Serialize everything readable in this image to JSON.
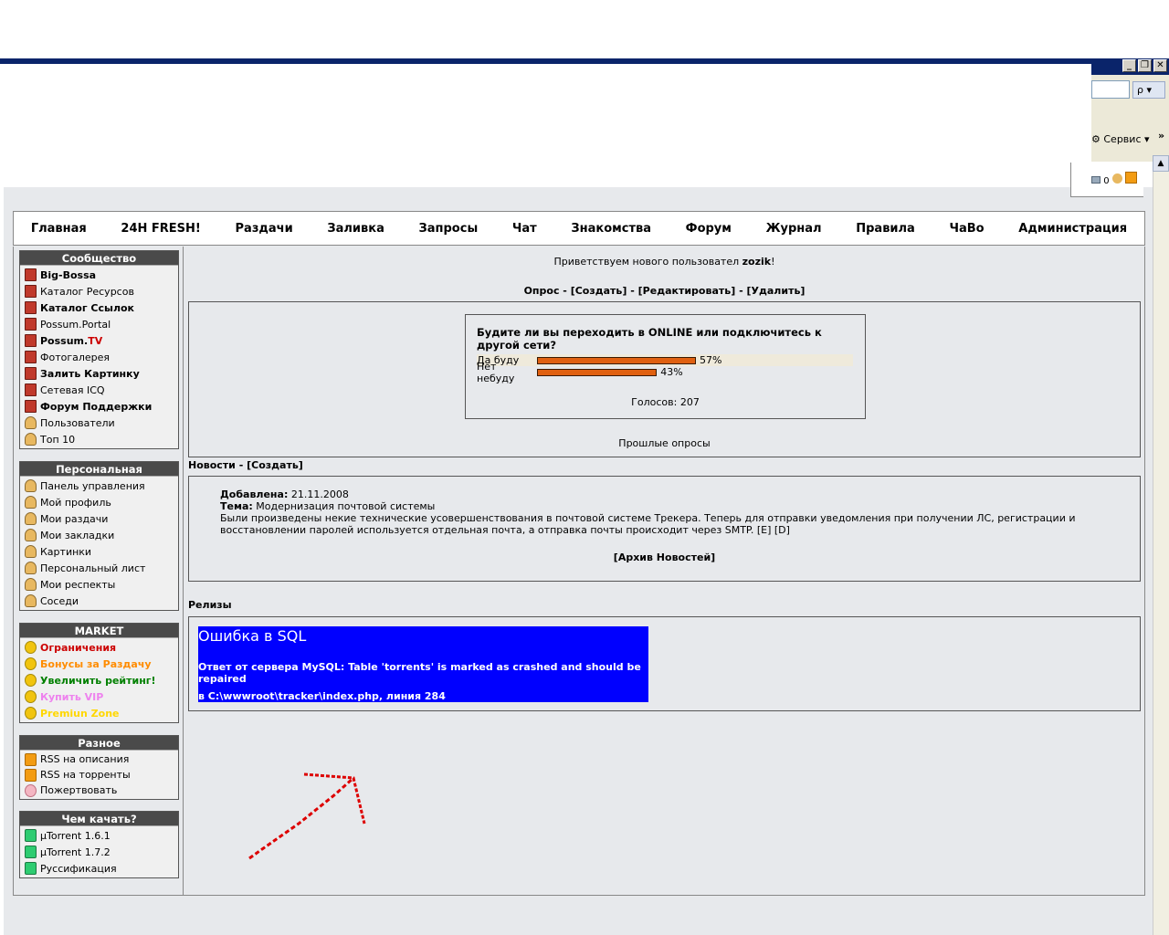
{
  "window": {
    "buttons": [
      "_",
      "❐",
      "✕"
    ]
  },
  "ie": {
    "service_label": "Сервис",
    "search_btn": "ρ ▾",
    "chevron": "»",
    "tray_count": "0"
  },
  "nav": [
    "Главная",
    "24H FRESH!",
    "Раздачи",
    "Заливка",
    "Запросы",
    "Чат",
    "Знакомства",
    "Форум",
    "Журнал",
    "Правила",
    "ЧаВо",
    "Администрация"
  ],
  "sidebar": {
    "community": {
      "title": "Сообщество",
      "items": [
        {
          "label": "Big-Bossa",
          "bold": true,
          "icon": "book-icon"
        },
        {
          "label": "Каталог Ресурсов",
          "bold": false,
          "icon": "book-icon"
        },
        {
          "label": "Каталог Ссылок",
          "bold": true,
          "icon": "book-icon"
        },
        {
          "label": "Possum.Portal",
          "bold": false,
          "icon": "book-icon"
        },
        {
          "label": "Possum.TV",
          "bold": true,
          "icon": "book-icon"
        },
        {
          "label": "Фотогалерея",
          "bold": false,
          "icon": "book-icon"
        },
        {
          "label": "Залить Картинку",
          "bold": true,
          "icon": "book-icon"
        },
        {
          "label": "Сетевая ICQ",
          "bold": false,
          "icon": "book-icon"
        },
        {
          "label": "Форум Поддержки",
          "bold": true,
          "icon": "book-icon"
        },
        {
          "label": "Пользователи",
          "bold": false,
          "icon": "users-icon"
        },
        {
          "label": "Топ 10",
          "bold": false,
          "icon": "users-icon"
        }
      ]
    },
    "personal": {
      "title": "Персональная",
      "items": [
        "Панель управления",
        "Мой профиль",
        "Мои раздачи",
        "Мои закладки",
        "Картинки",
        "Персональный лист",
        "Мои респекты",
        "Соседи"
      ]
    },
    "market": {
      "title": "MARKET",
      "items": [
        {
          "label": "Ограничения",
          "color": "#cc0000"
        },
        {
          "label": "Бонусы за Раздачу",
          "color": "#ff8c00"
        },
        {
          "label": "Увеличить рейтинг!",
          "color": "#008000"
        },
        {
          "label": "Купить VIP",
          "color": "#ee82ee"
        },
        {
          "label": "Premiun Zone",
          "color": "#ffd700"
        }
      ]
    },
    "misc": {
      "title": "Разное",
      "items": [
        "RSS на описания",
        "RSS на торренты",
        "Пожертвовать"
      ]
    },
    "clients": {
      "title": "Чем качать?",
      "items": [
        "µTorrent 1.6.1",
        "µTorrent 1.7.2",
        "Руссификация"
      ]
    }
  },
  "welcome": {
    "text": "Приветствуем нового пользовател ",
    "user": "zozik",
    "suffix": "!"
  },
  "poll": {
    "header": "Опрос",
    "create": "[Создать]",
    "edit": "[Редактировать]",
    "delete": "[Удалить]",
    "question": "Будите ли вы переходить в ONLINE или подключитесь к другой сети?",
    "options": [
      {
        "label": "Да буду",
        "percent": 57,
        "text": "57%"
      },
      {
        "label": "Нет небуду",
        "percent": 43,
        "text": "43%"
      }
    ],
    "votes": "Голосов: 207",
    "past": "Прошлые опросы"
  },
  "news": {
    "header": "Новости",
    "create": "[Создать]",
    "added_label": "Добавлена:",
    "added_date": "21.11.2008",
    "topic_label": "Тема:",
    "topic": "Модернизация почтовой системы",
    "body": "Были произведены некие технические усовершенствования в почтовой системе Трекера. Теперь для отправки уведомления при получении ЛС, регистрации и восстановлении паролей используется отдельная почта, а отправка почты происходит через SMTP.",
    "e": "[E]",
    "d": "[D]",
    "archive": "[Архив Новостей]"
  },
  "releases": {
    "header": "Релизы",
    "error_title": "Ошибка в SQL",
    "error_msg": "Ответ от сервера MySQL: Table 'torrents' is marked as crashed and should be repaired",
    "error_loc": "в C:\\wwwroot\\tracker\\index.php, линия 284"
  },
  "colors": {
    "page_bg": "#e7e9ec",
    "box_head": "#4a4a4a",
    "error_bg": "#0000ff",
    "arrow": "#dd0000",
    "bar": "#e06010"
  }
}
